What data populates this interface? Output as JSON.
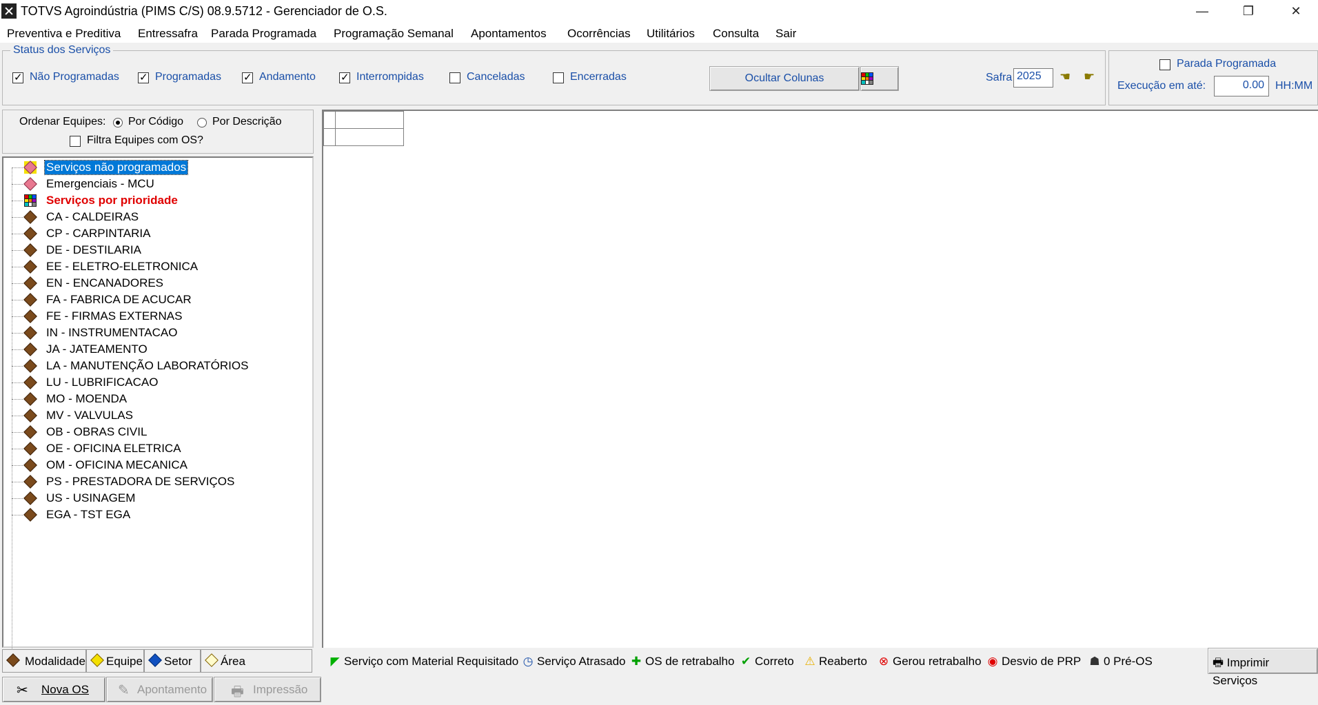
{
  "window": {
    "title": "TOTVS Agroindústria (PIMS C/S) 08.9.5712 - Gerenciador de O.S.",
    "minimize": "—",
    "maximize": "❐",
    "close": "✕"
  },
  "menu": [
    "Preventiva e Preditiva",
    "Entressafra",
    "Parada Programada",
    "Programação Semanal",
    "Apontamentos",
    "Ocorrências",
    "Utilitários",
    "Consulta",
    "Sair"
  ],
  "status_group": {
    "legend": "Status dos Serviços",
    "checkboxes": [
      {
        "label": "Não Programadas",
        "checked": true
      },
      {
        "label": "Programadas",
        "checked": true
      },
      {
        "label": "Andamento",
        "checked": true
      },
      {
        "label": "Interrompidas",
        "checked": true
      },
      {
        "label": "Canceladas",
        "checked": false
      },
      {
        "label": "Encerradas",
        "checked": false
      }
    ],
    "hide_columns_button": "Ocultar Colunas",
    "safra_label": "Safra",
    "safra_value": "2025"
  },
  "parada": {
    "checkbox_label": "Parada Programada",
    "checked": false,
    "exec_label": "Execução em até:",
    "exec_value": "0.00",
    "unit": "HH:MM"
  },
  "left_options": {
    "order_label": "Ordenar Equipes:",
    "by_code": "Por Código",
    "by_desc": "Por Descrição",
    "by_code_selected": true,
    "filter_label": "Filtra Equipes com OS?",
    "filter_checked": false
  },
  "tree": [
    {
      "label": "Serviços não programados",
      "icon": "gem-yellow-icon",
      "selected": true
    },
    {
      "label": "Emergenciais - MCU",
      "icon": "gem-pink-icon"
    },
    {
      "label": "Serviços por prioridade",
      "icon": "color-grid-icon",
      "bold_red": true
    },
    {
      "label": "CA - CALDEIRAS",
      "icon": "gem-brown-icon"
    },
    {
      "label": "CP - CARPINTARIA",
      "icon": "gem-brown-icon"
    },
    {
      "label": "DE - DESTILARIA",
      "icon": "gem-brown-icon"
    },
    {
      "label": "EE - ELETRO-ELETRONICA",
      "icon": "gem-brown-icon"
    },
    {
      "label": "EN - ENCANADORES",
      "icon": "gem-brown-icon"
    },
    {
      "label": "FA - FABRICA DE ACUCAR",
      "icon": "gem-brown-icon"
    },
    {
      "label": "FE - FIRMAS EXTERNAS",
      "icon": "gem-brown-icon"
    },
    {
      "label": "IN - INSTRUMENTACAO",
      "icon": "gem-brown-icon"
    },
    {
      "label": "JA - JATEAMENTO",
      "icon": "gem-brown-icon"
    },
    {
      "label": "LA - MANUTENÇÃO LABORATÓRIOS",
      "icon": "gem-brown-icon"
    },
    {
      "label": "LU - LUBRIFICACAO",
      "icon": "gem-brown-icon"
    },
    {
      "label": "MO - MOENDA",
      "icon": "gem-brown-icon"
    },
    {
      "label": "MV - VALVULAS",
      "icon": "gem-brown-icon"
    },
    {
      "label": "OB - OBRAS CIVIL",
      "icon": "gem-brown-icon"
    },
    {
      "label": "OE - OFICINA ELETRICA",
      "icon": "gem-brown-icon"
    },
    {
      "label": "OM - OFICINA MECANICA",
      "icon": "gem-brown-icon"
    },
    {
      "label": "PS - PRESTADORA DE SERVIÇOS",
      "icon": "gem-brown-icon"
    },
    {
      "label": "US - USINAGEM",
      "icon": "gem-brown-icon"
    },
    {
      "label": "EGA - TST EGA",
      "icon": "gem-brown-icon"
    }
  ],
  "tabs": [
    "Modalidade",
    "Equipe",
    "Setor",
    "Área"
  ],
  "legend": [
    {
      "label": "Serviço com Material Requisitado",
      "icon": "green-flag-icon"
    },
    {
      "label": "Serviço Atrasado",
      "icon": "clock-icon"
    },
    {
      "label": "OS de retrabalho",
      "icon": "plus-icon"
    },
    {
      "label": "Correto",
      "icon": "check-icon"
    },
    {
      "label": "Reaberto",
      "icon": "warning-icon"
    },
    {
      "label": "Gerou retrabalho",
      "icon": "error-icon"
    },
    {
      "label": "Desvio de PRP",
      "icon": "target-icon"
    },
    {
      "label": "0 Pré-OS",
      "icon": "people-icon"
    }
  ],
  "print_button": "Imprimir Serviços",
  "bottom_buttons": {
    "new_os": "Nova OS",
    "apontamento": "Apontamento",
    "impressao": "Impressão"
  }
}
